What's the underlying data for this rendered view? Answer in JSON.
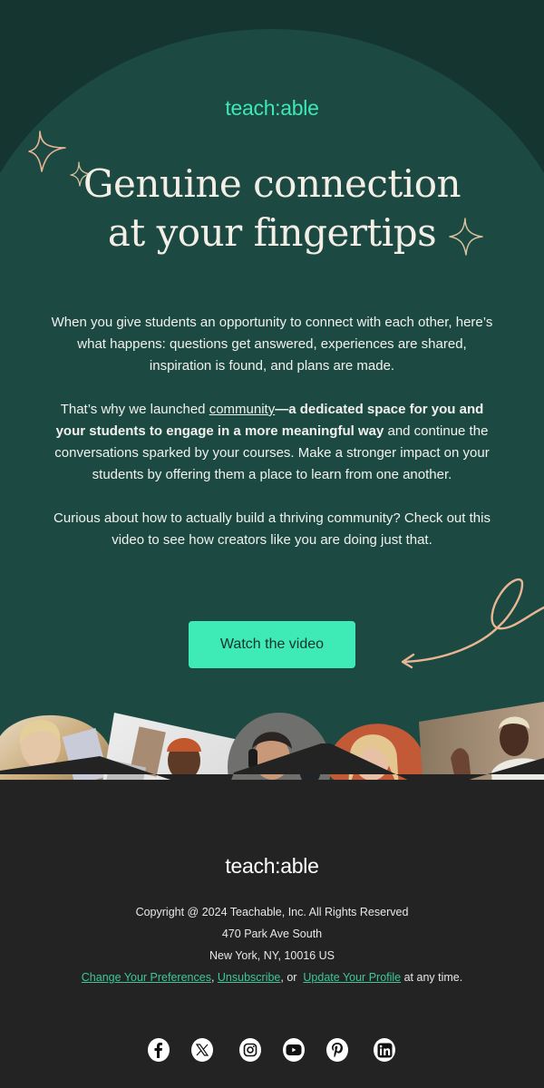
{
  "brand": {
    "logo_text": "teach:able",
    "accent": "#3ee8b5",
    "background_dark": "#143530",
    "arch": "#1c4a43",
    "footer_bg": "#232323"
  },
  "hero": {
    "headline_line1": "Genuine connection",
    "headline_line2": "at your fingertips"
  },
  "body": {
    "paragraph1": "When you give students an opportunity to connect with each other, here’s what happens: questions get answered, experiences are shared, inspiration is found, and plans are made.",
    "paragraph2_intro": "That’s why we launched ",
    "paragraph2_link": "community",
    "paragraph2_dash": "—",
    "paragraph2_bold": "a dedicated space for you and your students to engage in a more meaningful way",
    "paragraph2_rest": " and continue the conversations sparked by your courses. Make a stronger impact on your students by offering them a place to learn from one another.",
    "paragraph3": "Curious about how to actually build a thriving community? Check out this video to see how creators like you are doing just that."
  },
  "cta": {
    "label": "Watch the video",
    "color": "#3eebb6"
  },
  "photos": [
    {
      "alt": "Woman with glasses painting"
    },
    {
      "alt": "Smiling woman in headwrap at laptop"
    },
    {
      "alt": "Man with headphones at microphone"
    },
    {
      "alt": "Blonde woman smiling"
    },
    {
      "alt": "Man with glasses waving"
    }
  ],
  "footer": {
    "logo_text": "teach:able",
    "copyright": "Copyright @ 2024 Teachable, Inc. All Rights Reserved",
    "address_line1": "470 Park Ave South",
    "address_line2": "New York, NY, 10016 US",
    "links": {
      "change_preferences": "Change Your Preferences",
      "sep1": ", ",
      "unsubscribe": "Unsubscribe",
      "sep2": ", or  ",
      "update_profile": "Update Your Profile",
      "suffix": " at any time."
    },
    "link_color": "#3ec79a",
    "socials": [
      {
        "name": "facebook-icon"
      },
      {
        "name": "x-icon"
      },
      {
        "name": "instagram-icon"
      },
      {
        "name": "youtube-icon"
      },
      {
        "name": "pinterest-icon"
      },
      {
        "name": "linkedin-icon"
      }
    ]
  }
}
